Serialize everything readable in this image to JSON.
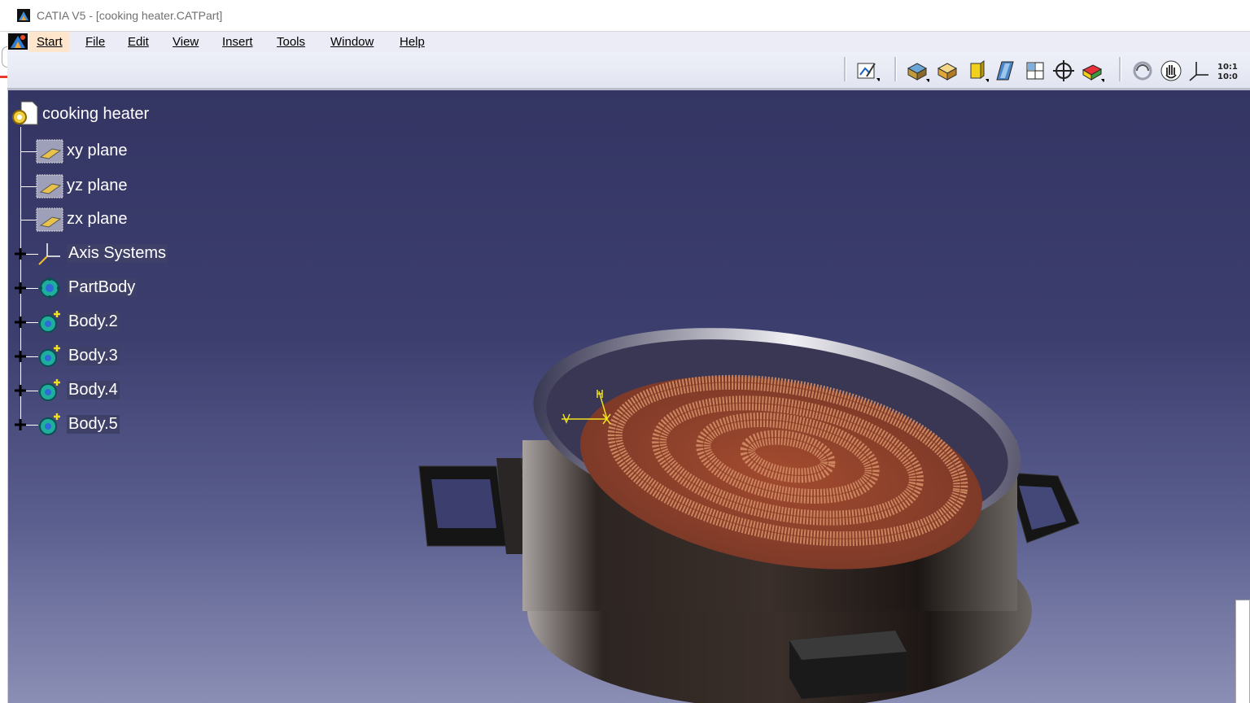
{
  "window": {
    "title": "CATIA V5 - [cooking heater.CATPart]"
  },
  "menu": {
    "items": [
      {
        "label": "Start"
      },
      {
        "label": "File"
      },
      {
        "label": "Edit"
      },
      {
        "label": "View"
      },
      {
        "label": "Insert"
      },
      {
        "label": "Tools"
      },
      {
        "label": "Window"
      },
      {
        "label": "Help"
      }
    ]
  },
  "toolbar": {
    "icons": [
      "sketcher-icon",
      "shaded-view-icon",
      "box-view-icon",
      "cylinder-view-icon",
      "parallelogram-icon",
      "multi-view-icon",
      "target-icon",
      "render-style-icon",
      "rotate-icon",
      "pan-hand-icon",
      "axis-icon",
      "scale-icon"
    ]
  },
  "tree": {
    "root": "cooking heater",
    "nodes": [
      {
        "label": "xy plane",
        "icon": "plane-icon"
      },
      {
        "label": "yz plane",
        "icon": "plane-icon"
      },
      {
        "label": "zx plane",
        "icon": "plane-icon"
      },
      {
        "label": "Axis Systems",
        "icon": "axis-system-icon"
      },
      {
        "label": "PartBody",
        "icon": "partbody-icon"
      },
      {
        "label": "Body.2",
        "icon": "body-icon"
      },
      {
        "label": "Body.3",
        "icon": "body-icon"
      },
      {
        "label": "Body.4",
        "icon": "body-icon"
      },
      {
        "label": "Body.5",
        "icon": "body-icon"
      }
    ]
  },
  "colors": {
    "viewport_top": "#343563",
    "viewport_bottom": "#8b8fb5",
    "coil": "#c0704e",
    "pan": "#5b4f4a"
  }
}
